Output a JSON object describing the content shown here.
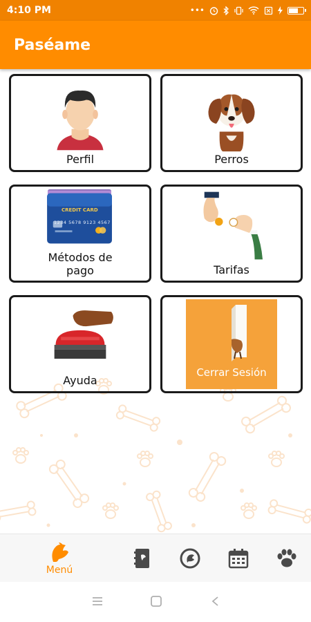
{
  "status_bar": {
    "time": "4:10 PM",
    "icons": [
      "more-icon",
      "alarm-icon",
      "bluetooth-icon",
      "vibrate-icon",
      "wifi-icon",
      "sim-icon",
      "charging-icon",
      "battery-icon"
    ]
  },
  "app_bar": {
    "title": "Paséame"
  },
  "menu_tiles": [
    {
      "label": "Perfil",
      "icon": "profile-icon"
    },
    {
      "label": "Perros",
      "icon": "dog-icon"
    },
    {
      "label": "Métodos de pago",
      "line1": "Métodos de",
      "line2": "pago",
      "icon": "credit-card-icon",
      "card_text": "CREDIT CARD",
      "card_number": "1234 5678 9123 4567"
    },
    {
      "label": "Tarifas",
      "icon": "payment-hands-icon"
    },
    {
      "label": "Ayuda",
      "icon": "help-buzzer-icon"
    },
    {
      "label": "Cerrar Sesión",
      "icon": "logout-door-icon"
    }
  ],
  "bottom_nav": {
    "items": [
      {
        "label": "Menú",
        "icon": "menu-dog-icon",
        "active": true
      },
      {
        "icon": "notebook-icon"
      },
      {
        "icon": "money-icon"
      },
      {
        "icon": "calendar-icon"
      },
      {
        "icon": "paw-icon"
      }
    ]
  },
  "colors": {
    "primary": "#FF8C00",
    "status_bar": "#F08200",
    "logout_tile": "#F5A23A"
  }
}
